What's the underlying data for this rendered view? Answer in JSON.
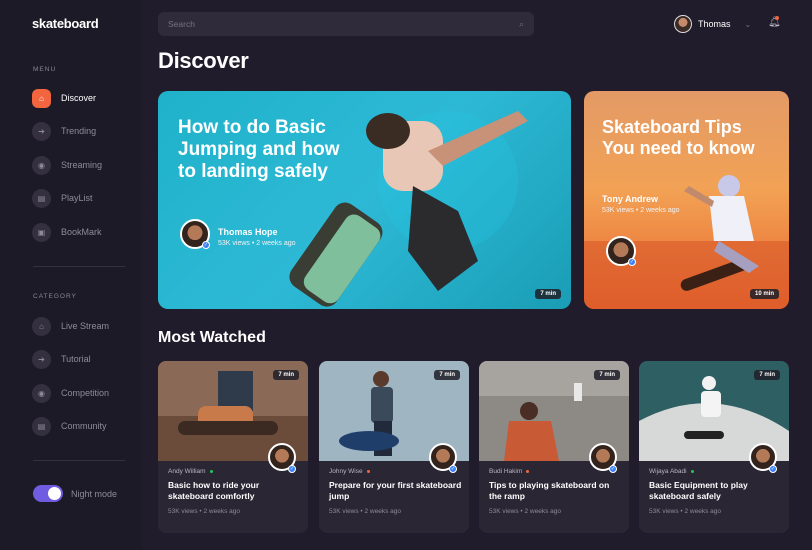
{
  "app": {
    "logo": "skateboard"
  },
  "sidebar": {
    "menu_label": "MENU",
    "menu_items": [
      {
        "label": "Discover",
        "icon": "home-icon",
        "active": true
      },
      {
        "label": "Trending",
        "icon": "arrow-right-icon",
        "active": false
      },
      {
        "label": "Streaming",
        "icon": "camera-icon",
        "active": false
      },
      {
        "label": "PlayList",
        "icon": "list-icon",
        "active": false
      },
      {
        "label": "BookMark",
        "icon": "bookmark-icon",
        "active": false
      }
    ],
    "category_label": "CATEGORY",
    "category_items": [
      {
        "label": "Live Stream",
        "icon": "home-icon"
      },
      {
        "label": "Tutorial",
        "icon": "arrow-right-icon"
      },
      {
        "label": "Competition",
        "icon": "camera-icon"
      },
      {
        "label": "Community",
        "icon": "list-icon"
      }
    ],
    "night_mode_label": "Night mode",
    "night_mode_on": true
  },
  "header": {
    "search_placeholder": "Search",
    "user_name": "Thomas"
  },
  "discover": {
    "title": "Discover",
    "featured": [
      {
        "title": "How to do Basic Jumping and how to landing safely",
        "author": "Thomas Hope",
        "meta": "53K views • 2 weeks ago",
        "duration": "7 min"
      },
      {
        "title": "Skateboard Tips You need to know",
        "author": "Tony Andrew",
        "meta": "53K views • 2 weeks ago",
        "duration": "10 min"
      }
    ]
  },
  "most_watched": {
    "title": "Most Watched",
    "videos": [
      {
        "author": "Andy William",
        "dot_color": "#22c55e",
        "title": "Basic how to ride your skateboard comfortly",
        "meta": "53K views • 2 weeks ago",
        "duration": "7 min"
      },
      {
        "author": "Johny Wise",
        "dot_color": "#f3653e",
        "title": "Prepare for your first skateboard jump",
        "meta": "53K views • 2 weeks ago",
        "duration": "7 min"
      },
      {
        "author": "Budi Hakim",
        "dot_color": "#f3653e",
        "title": "Tips to playing skateboard on the ramp",
        "meta": "53K views • 2 weeks ago",
        "duration": "7 min"
      },
      {
        "author": "Wijaya Abadi",
        "dot_color": "#22c55e",
        "title": "Basic Equipment to play skateboard safely",
        "meta": "53K views • 2 weeks ago",
        "duration": "7 min"
      }
    ]
  },
  "colors": {
    "accent": "#f3653e",
    "toggle": "#6f5ce0",
    "background": "#201c2b"
  }
}
